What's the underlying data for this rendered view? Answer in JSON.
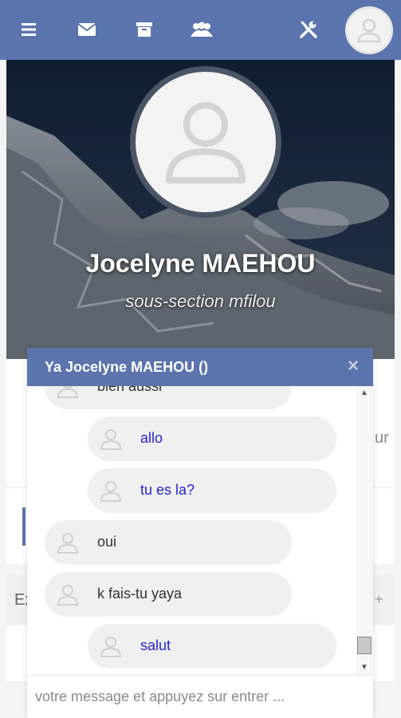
{
  "topbar": {
    "icons": [
      "menu-icon",
      "mail-icon",
      "archive-icon",
      "group-icon",
      "tools-icon",
      "avatar"
    ],
    "color": "#5b74ad"
  },
  "profile": {
    "name": "Jocelyne MAEHOU",
    "subtitle": "sous-section mfilou"
  },
  "background_fragments": {
    "right_text": "ur",
    "left_text": "Ex"
  },
  "chat": {
    "title": "Ya Jocelyne MAEHOU ()",
    "close_label": "×",
    "messages": [
      {
        "from": "them",
        "text": "bien aussi"
      },
      {
        "from": "me",
        "text": "allo"
      },
      {
        "from": "me",
        "text": "tu es la?"
      },
      {
        "from": "them",
        "text": "oui"
      },
      {
        "from": "them",
        "text": "k fais-tu yaya"
      },
      {
        "from": "me",
        "text": "salut"
      }
    ],
    "input_placeholder": "votre message et appuyez sur entrer ...",
    "input_value": ""
  },
  "colors": {
    "accent": "#5b74ad",
    "my_message_text": "#2424d6",
    "bubble_bg": "#f0f0f0"
  }
}
